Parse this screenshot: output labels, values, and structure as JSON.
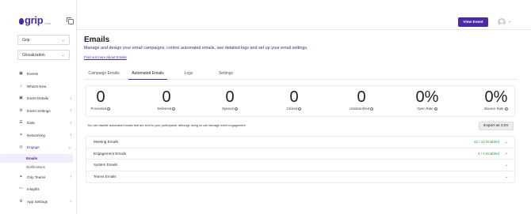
{
  "app": {
    "logo_text": "grip",
    "logo_sub": "beta"
  },
  "sidebar": {
    "event_select": "Grip",
    "community_select": "Glocalization",
    "items": [
      {
        "label": "Events",
        "icon": "calendar-icon",
        "has_arrow": false
      },
      {
        "label": "What's New",
        "icon": "bell-icon",
        "has_arrow": false
      },
      {
        "label": "Event Details",
        "icon": "calendar-icon",
        "has_arrow": true
      },
      {
        "label": "Event Settings",
        "icon": "gear-icon",
        "has_arrow": true
      },
      {
        "label": "Data",
        "icon": "database-icon",
        "has_arrow": true
      },
      {
        "label": "Networking",
        "icon": "network-icon",
        "has_arrow": true
      },
      {
        "label": "Engage",
        "icon": "megaphone-icon",
        "has_arrow": true,
        "expanded": true
      }
    ],
    "engage_sub": [
      {
        "label": "Emails",
        "active": true
      },
      {
        "label": "Notifications",
        "active": false
      }
    ],
    "items_after": [
      {
        "label": "Grip Teams",
        "icon": "team-icon",
        "has_arrow": true
      },
      {
        "label": "Insights",
        "icon": "chart-icon",
        "has_arrow": false
      },
      {
        "label": "App Settings",
        "icon": "gear-icon",
        "has_arrow": true
      }
    ]
  },
  "topbar": {
    "view_event_label": "View Event"
  },
  "main": {
    "title": "Emails",
    "description": "Manage and design your email campaigns, control automated emails, see detailed logs and set up your email settings.",
    "link": "Find out more about Emails",
    "tabs": [
      {
        "label": "Campaign Emails",
        "active": false
      },
      {
        "label": "Automated Emails",
        "active": true
      },
      {
        "label": "Logs",
        "active": false
      },
      {
        "label": "Settings",
        "active": false
      }
    ],
    "stats": [
      {
        "value": "0",
        "label": "Processed"
      },
      {
        "value": "0",
        "label": "Delivered"
      },
      {
        "value": "0",
        "label": "Opened"
      },
      {
        "value": "0",
        "label": "Clicked"
      },
      {
        "value": "0",
        "label": "Unsubscribed"
      },
      {
        "value": "0%",
        "label": "Open Rate"
      },
      {
        "value": "0%",
        "label": "Bounce Rate"
      }
    ],
    "note": "You can disable automated emails that are sent to your participants, although doing so can damage event engagement.",
    "export_label": "Export as CSV",
    "groups": [
      {
        "label": "Meeting Emails",
        "badge": "12 / 12 Enabled"
      },
      {
        "label": "Engagement Emails",
        "badge": "4 / 4 Enabled"
      },
      {
        "label": "System Emails",
        "badge": ""
      },
      {
        "label": "Teams Emails",
        "badge": ""
      }
    ]
  },
  "colors": {
    "brand": "#4b2aa3",
    "enabled": "#2e9e3e"
  }
}
